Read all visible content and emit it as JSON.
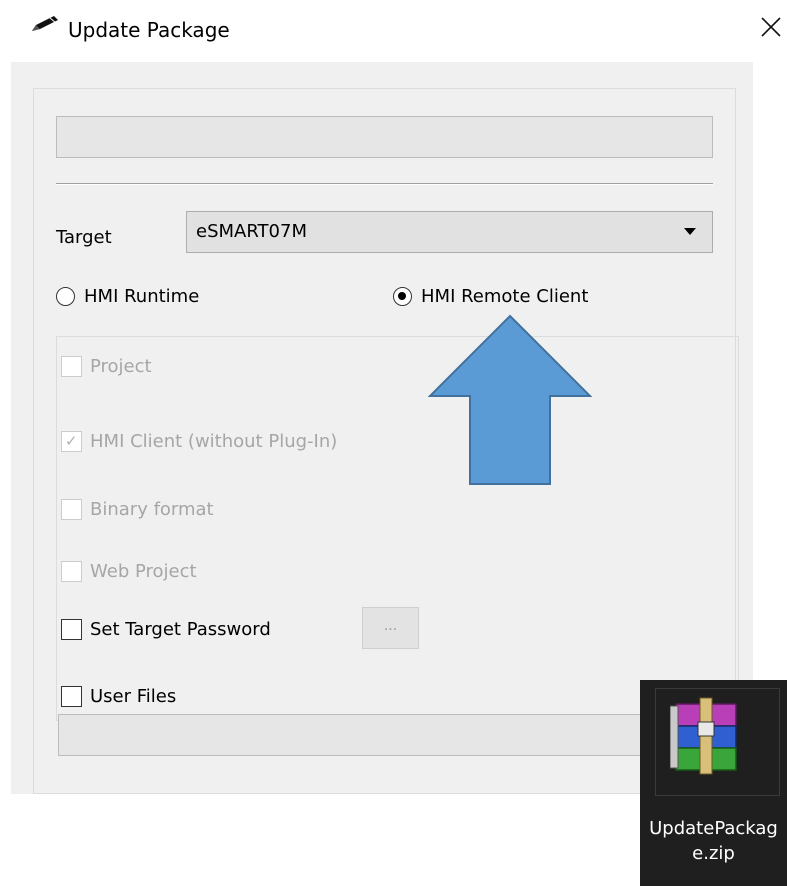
{
  "window": {
    "title": "Update Package",
    "title_icon": "pencil-icon",
    "close_icon": "close-icon"
  },
  "form": {
    "target_label": "Target",
    "target_value": "eSMART07M",
    "radio_runtime": "HMI Runtime",
    "radio_runtime_selected": false,
    "radio_remote": "HMI Remote Client",
    "radio_remote_selected": true,
    "options": [
      {
        "label": "Project",
        "checked": false,
        "enabled": false
      },
      {
        "label": "HMI Client (without Plug-In)",
        "checked": true,
        "enabled": false
      },
      {
        "label": "Binary format",
        "checked": false,
        "enabled": false
      },
      {
        "label": "Web Project",
        "checked": false,
        "enabled": false
      },
      {
        "label": "Set Target Password",
        "checked": false,
        "enabled": true
      },
      {
        "label": "User Files",
        "checked": false,
        "enabled": true
      }
    ],
    "password_button_label": "..."
  },
  "annotation": {
    "arrow_color": "#5b9bd5",
    "arrow_icon": "up-arrow-annotation"
  },
  "desktop": {
    "file_name": "UpdatePackage.zip",
    "file_icon": "winrar-archive-icon"
  }
}
